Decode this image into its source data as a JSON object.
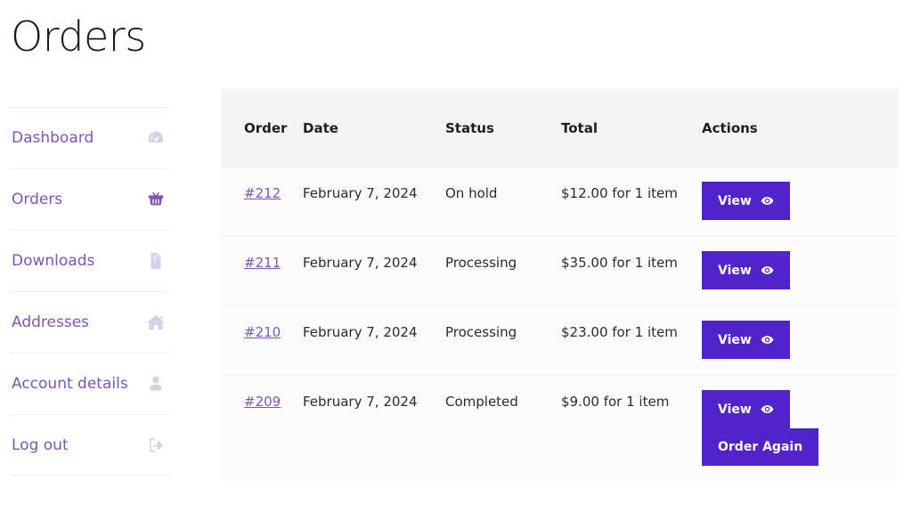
{
  "page": {
    "title": "Orders"
  },
  "sidebar": {
    "items": [
      {
        "label": "Dashboard",
        "icon": "speedometer-icon",
        "active": false
      },
      {
        "label": "Orders",
        "icon": "basket-icon",
        "active": true
      },
      {
        "label": "Downloads",
        "icon": "file-download-icon",
        "active": false
      },
      {
        "label": "Addresses",
        "icon": "home-icon",
        "active": false
      },
      {
        "label": "Account details",
        "icon": "user-icon",
        "active": false
      },
      {
        "label": "Log out",
        "icon": "logout-icon",
        "active": false
      }
    ]
  },
  "table": {
    "columns": [
      "Order",
      "Date",
      "Status",
      "Total",
      "Actions"
    ],
    "rows": [
      {
        "order": "#212",
        "date": "February 7, 2024",
        "status": "On hold",
        "total": "$12.00 for 1 item",
        "actions": [
          "View"
        ]
      },
      {
        "order": "#211",
        "date": "February 7, 2024",
        "status": "Processing",
        "total": "$35.00 for 1 item",
        "actions": [
          "View"
        ]
      },
      {
        "order": "#210",
        "date": "February 7, 2024",
        "status": "Processing",
        "total": "$23.00 for 1 item",
        "actions": [
          "View"
        ]
      },
      {
        "order": "#209",
        "date": "February 7, 2024",
        "status": "Completed",
        "total": "$9.00 for 1 item",
        "actions": [
          "View",
          "Order Again"
        ]
      }
    ]
  },
  "colors": {
    "link_purple": "#7f54b3",
    "button_purple": "#5123ca",
    "header_bg": "#f5f5f5",
    "row_bg": "#fcfcfc",
    "icon_muted": "#d9d0e8",
    "title_text": "#1a1a1a"
  }
}
